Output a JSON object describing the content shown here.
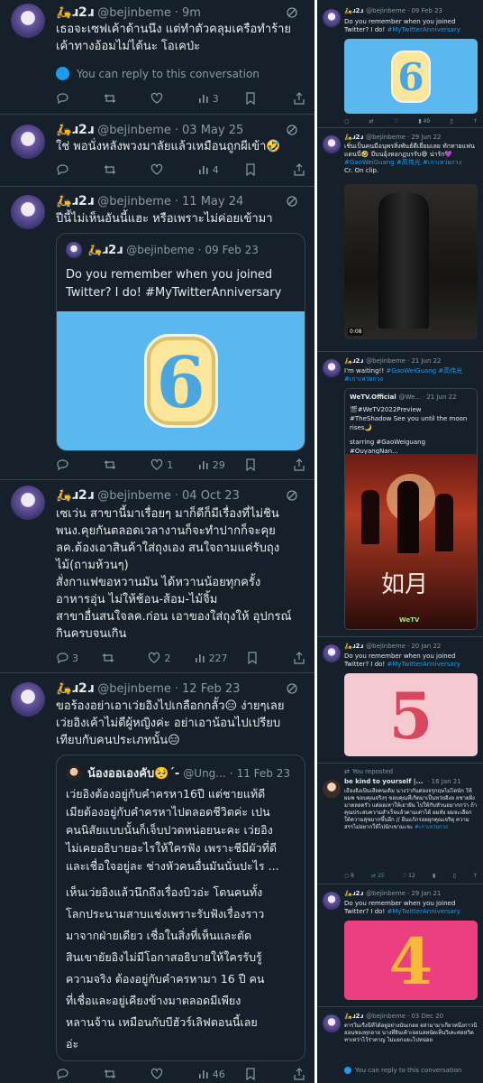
{
  "left": {
    "tweets": [
      {
        "name": "🛵ɹ2ɹ",
        "handle": "@bejinbeme",
        "time": "9m",
        "text": "เธอจะเซฟเค้าด้านนึง แต่ทำตัวคลุมเครือทำร้ายเค้าทางอ้อมไม่ได้นะ โอเคป่ะ",
        "reply_note": "You can reply to this conversation",
        "views": "3"
      },
      {
        "name": "🛵ɹ2ɹ",
        "handle": "@bejinbeme",
        "time": "03 May 25",
        "text": "ใช่ พอนั่งหลังพวงมาลัยแล้วเหมือนถูกผีเข้า🤣",
        "views": "4"
      },
      {
        "name": "🛵ɹ2ɹ",
        "handle": "@bejinbeme",
        "time": "11 May 24",
        "text": "ปีนี้ไม่เห็นอันนี้แฮะ หรือเพราะไม่ค่อยเข้ามา",
        "quote": {
          "name": "🛵ɹ2ɹ",
          "handle": "@bejinbeme",
          "time": "09 Feb 23",
          "text": "Do you remember when you joined Twitter? I do! #MyTwitterAnniversary",
          "badge": "6"
        },
        "likes": "1",
        "views": "29"
      },
      {
        "name": "🛵ɹ2ɹ",
        "handle": "@bejinbeme",
        "time": "04 Oct 23",
        "text_lines": [
          "เซเว่น สาขานี้มาเรื่อยๆ มาก็ดีก็มีเรื่องที่ไม่ชิน",
          "พนง.คุยกันตลอดเวลางานก็จะทำปากก็จะคุย",
          "ลค.ต้องเอาสินค้าใส่ถุงเอง สนใจถามแค่รับถุง",
          "ไม้(ถามห้วนๆ)",
          "สั่งกาแฟขอหวานมัน ได้หวานน้อยทุกครั้ง",
          "อาหารอุ่น ไม่ให้ช้อน-ส้อม-ไม้จิ้ม",
          "สาขาอื่นสนใจลค.ก่อน เอาของใส่ถุงให้ อุปกรณ์",
          "กินครบจนเกิน"
        ],
        "replies": "3",
        "likes": "2",
        "views": "227"
      },
      {
        "name": "🛵ɹ2ɹ",
        "handle": "@bejinbeme",
        "time": "12 Feb 23",
        "text_lines": [
          "ขอร้องอย่าเอาเว่ยอิงไปเกลือกกลั้ว😑 ง่ายๆเลย",
          "เว่ยอิงเค้าไม่ดีผู้หญิงค่ะ อย่าเอาน้อนไปเปรียบ",
          "เทียบกับคนประเภทนั้น😑"
        ],
        "quote": {
          "name": "น้องออเองคับ🥺´-",
          "handle": "@Ung...",
          "time": "11 Feb 23",
          "p1": [
            "เว่ยอิงต้องอยู่กับคำครหา16ปี แต่ชายแท้ดี",
            "เมียต้องอยู่กับคำครหาไปตลอดชีวิตค่ะ เปน",
            "คนนิสัยแบบนั้นก็เจ็บปวดหน่อยนะคะ เว่ยอิง",
            "ไม่เคยอธิบายอะไรให้ใครฟัง เพราะชีมีผัวที่ดี",
            "และเชื่อใจอยู่ละ ช่างหัวคนอื่นมันนั่นปะไร ..."
          ],
          "p2": [
            "เห็นเว่ยอิงแล้วนึกถึงเรื่องบิวอ่ะ โดนคนทั้ง",
            "โลกประนามสาบแช่งเพราะรับฟังเรื่องราว",
            "มาจากฝ่ายเดียว เชื่อในสิ่งที่เห็นและตัด",
            "สินเขายัยอิงไม่มีโอกาสอธิบายให้ใครรับรู้",
            "ความจริง ต้องอยู่กับคำครหามา 16 ปี คน",
            "ที่เชื่อและอยู่เคียงข้างมาตลอดมีเพียง",
            "หลานจ้าน เหมือนกับบีฮัวร์เลิฟตอนนี้เลย",
            "อ่ะ"
          ]
        },
        "views": "46"
      }
    ]
  },
  "right": {
    "tweets": [
      {
        "name": "🛵ɹ2ɹ",
        "handle": "@bejinbeme",
        "time": "09 Feb 23",
        "text": "Do you remember when you joined Twitter? I do!",
        "tag": "#MyTwitterAnniversary",
        "badge": "6",
        "views": "49"
      },
      {
        "name": "🛵ɹ2ɹ",
        "handle": "@bejinbeme",
        "time": "29 Jun 22",
        "text": "เชิ่นเป็นคนมีอนุพรสิ่งพันธ์ดีเยี่ยมเลย ทักทายแฟนแดนนี่🤣 มีบนอุ้งหอกฎบรรับ😄 น่ารัก💜",
        "tags": "#GaoWeiGuang #高伟光 #เกาเหว่ยกวง",
        "credit": "Cr. On clip.",
        "duration": "0:08"
      },
      {
        "name": "🛵ɹ2ɹ",
        "handle": "@bejinbeme",
        "time": "21 Jun 22",
        "text": "I'm waiting!!",
        "tags": "#GaoWeiGuang #高伟光 #เกาเหว่ยกวง",
        "quote": {
          "name": "WeTV.Official",
          "handle": "@We...",
          "time": "21 Jun 22",
          "l1": "🎬#WeTV2022Preview",
          "l2": "#TheShadow See you until the moon rises🌙",
          "l3": "starring #GaoWeiguang #OuyangNan...",
          "poster_title": "如月",
          "brand": "WeTV"
        }
      },
      {
        "name": "🛵ɹ2ɹ",
        "handle": "@bejinbeme",
        "time": "20 Jan 22",
        "text": "Do you remember when you joined Twitter? I do!",
        "tag": "#MyTwitterAnniversary",
        "badge": "5"
      },
      {
        "reposted": "You reposted",
        "name": "be kind to yourself |...",
        "handle": "",
        "time": "16 Jan 21",
        "text": "เธียงอิงเป็นเสียคนเดิม นางว่ากันต่องจรุกฤษไม่โดนัก ให้ผมพ ขอบคุณจริงๆ ขอบคุณที่เกิดมาเป็นหว่ยอิงอ ยชายฝั่งมาตลอดรัว แต่ออเหาให้เอาฝัน ไปให้กับหัวนอมากกว่า ถ้าคุณประสบความสำเร็จแล้วตามเต่าได้ ผมทัง ผมจะเลือกใต้ความสุขมากขึ้นอีก // อีนแก้กรอยยุกคุณเจริตุ ความสรรไม่อยากให้ไปนักเขามะจะ",
        "tag": "#เกาเหว่ยกวง",
        "r": "8",
        "rt": "25",
        "lk": "12",
        "vw": ""
      },
      {
        "name": "🛵ɹ2ɹ",
        "handle": "@bejinbeme",
        "time": "29 Jan 21",
        "text": "Do you remember when you joined Twitter? I do!",
        "tag": "#MyTwitterAnniversary",
        "badge": "4"
      },
      {
        "name": "🛵ɹ2ɹ",
        "handle": "@bejinbeme",
        "time": "03 Dec 20",
        "text": "ดารในเรื่งนี้ที่ได้อยู่อย่างนั้นเกอย อย่ามามาเกี่ยวหนึ่งกาวนี่ออนชองทุกอาย นางที่ยินเค้าเจอนลหนัดเท็นวิเคะค่อหวิต ทาเหว่าไว้ร่าคาญ ไม่แยกแยะไปหน่อย",
        "reply_note": "You can reply to this conversation"
      }
    ]
  },
  "colors": {
    "bg": "#15202b",
    "border": "#38444d",
    "muted": "#8b98a5",
    "accent": "#1d9bf0",
    "text": "#e7e9ea"
  }
}
